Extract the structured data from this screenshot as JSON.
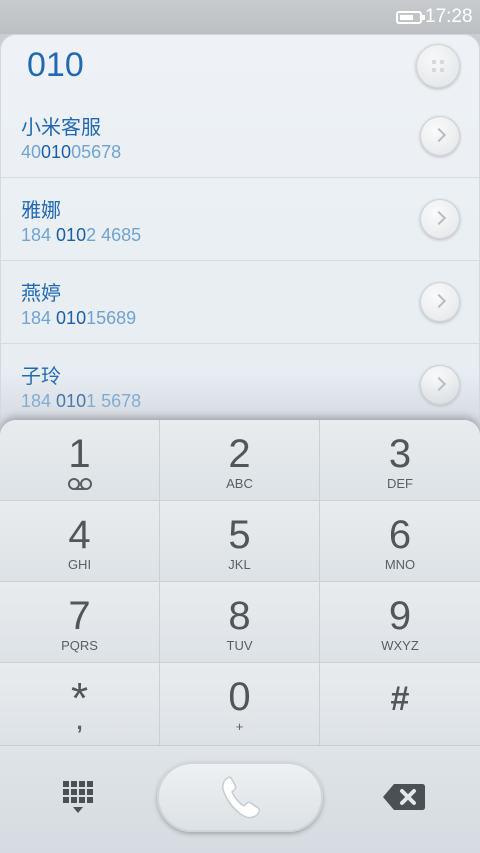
{
  "status_bar": {
    "time": "17:28",
    "battery_icon": "battery-icon"
  },
  "dialer": {
    "input": "010"
  },
  "contacts": [
    {
      "name": "小米客服",
      "number_parts": [
        "40",
        "010",
        "05678"
      ]
    },
    {
      "name": "雅娜",
      "number_parts": [
        "184 ",
        "010",
        "2 4685"
      ]
    },
    {
      "name": "燕婷",
      "number_parts": [
        "184 ",
        "010",
        "15689"
      ]
    },
    {
      "name": "子玲",
      "number_parts": [
        "184 ",
        "010",
        "1 5678"
      ]
    }
  ],
  "keypad": {
    "keys": [
      {
        "digit": "1",
        "letters": ""
      },
      {
        "digit": "2",
        "letters": "ABC"
      },
      {
        "digit": "3",
        "letters": "DEF"
      },
      {
        "digit": "4",
        "letters": "GHI"
      },
      {
        "digit": "5",
        "letters": "JKL"
      },
      {
        "digit": "6",
        "letters": "MNO"
      },
      {
        "digit": "7",
        "letters": "PQRS"
      },
      {
        "digit": "8",
        "letters": "TUV"
      },
      {
        "digit": "9",
        "letters": "WXYZ"
      },
      {
        "digit": "*",
        "letters": ","
      },
      {
        "digit": "0",
        "letters": "+"
      },
      {
        "digit": "#",
        "letters": ""
      }
    ]
  },
  "icons": {
    "collapse": "dots-icon",
    "detail": "chevron-right-icon",
    "voicemail": "voicemail-icon",
    "dialpad": "grid-icon",
    "call": "phone-icon",
    "backspace": "backspace-icon"
  },
  "colors": {
    "accent": "#2269b0",
    "number_muted": "#6fa3d2",
    "call_icon": "#ffffff"
  }
}
